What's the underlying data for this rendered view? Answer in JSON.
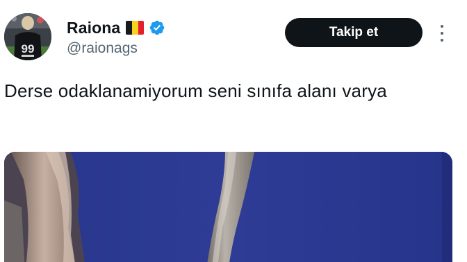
{
  "tweet": {
    "display_name": "Raiona",
    "handle": "@raionags",
    "follow_label": "Takip et",
    "text": "Derse odaklanamiyorum seni sınıfa alanı varya",
    "flag_colors": [
      "#1a1a1a",
      "#f7d21f",
      "#e3202b"
    ],
    "verified_color": "#1d9bf0",
    "icons": {
      "avatar": "profile-photo",
      "verified": "verified-badge-icon",
      "more": "more-options-icon",
      "flag": "belgium-flag-icon"
    },
    "avatar_jersey_number": "99"
  }
}
